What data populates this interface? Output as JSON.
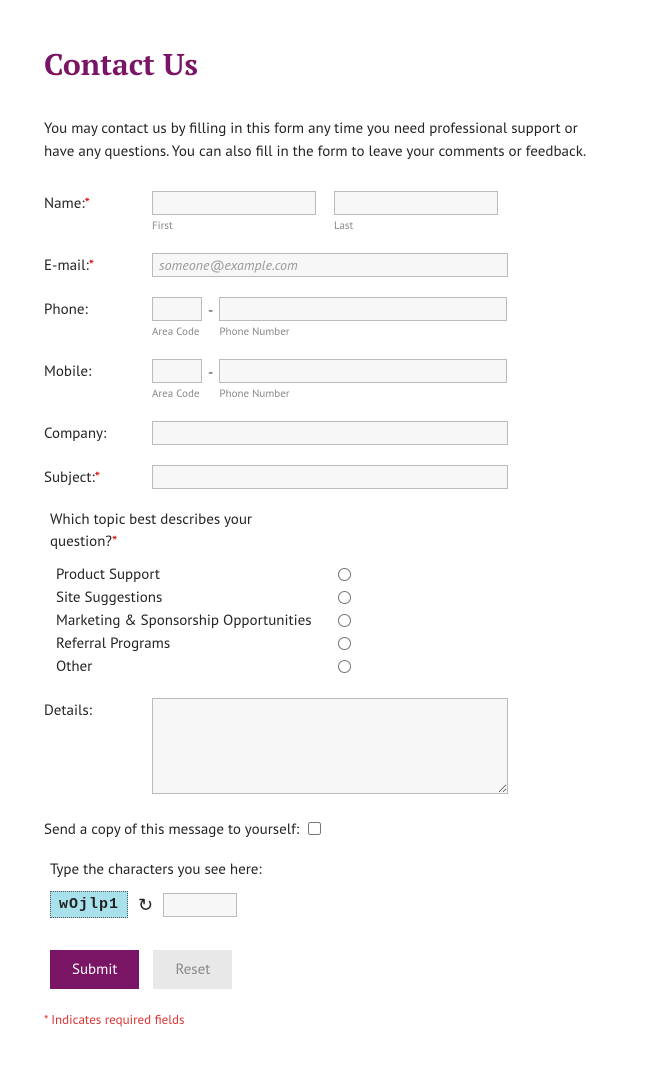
{
  "title": "Contact Us",
  "intro": "You may contact us by filling in this form any time you need professional support or have any questions. You can also fill in the form to leave your comments or feedback.",
  "labels": {
    "name": "Name:",
    "email": "E-mail:",
    "phone": "Phone:",
    "mobile": "Mobile:",
    "company": "Company:",
    "subject": "Subject:",
    "details": "Details:",
    "first": "First",
    "last": "Last",
    "area_code": "Area Code",
    "phone_number": "Phone Number",
    "copy_self": "Send a copy of this message to yourself:",
    "captcha": "Type the characters you see here:",
    "required_mark": "*"
  },
  "placeholders": {
    "email": "someone@example.com"
  },
  "topic": {
    "question": "Which topic best describes your question?",
    "options": [
      "Product Support",
      "Site Suggestions",
      "Marketing & Sponsorship Opportunities",
      "Referral Programs",
      "Other"
    ]
  },
  "captcha_text": "wOjlp1",
  "buttons": {
    "submit": "Submit",
    "reset": "Reset"
  },
  "footnote": "* Indicates required fields"
}
